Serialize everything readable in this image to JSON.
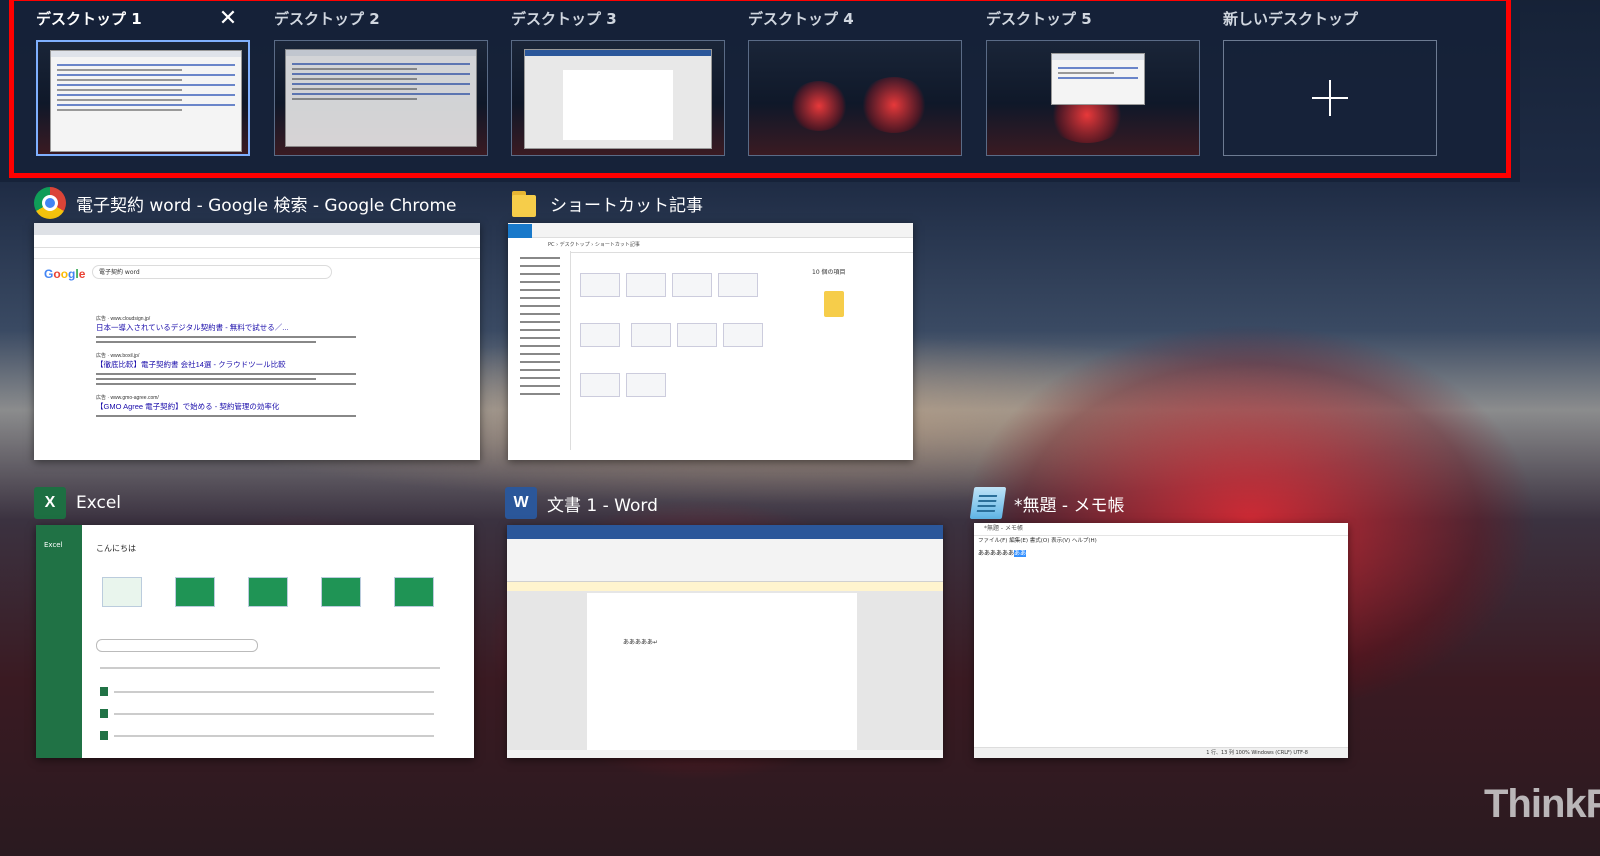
{
  "desktops": [
    {
      "label": "デスクトップ 1",
      "active": true
    },
    {
      "label": "デスクトップ 2",
      "active": false
    },
    {
      "label": "デスクトップ 3",
      "active": false
    },
    {
      "label": "デスクトップ 4",
      "active": false
    },
    {
      "label": "デスクトップ 5",
      "active": false
    }
  ],
  "new_desktop": {
    "label": "新しいデスクトップ"
  },
  "windows": {
    "chrome": {
      "title": "電子契約 word - Google 検索 - Google Chrome",
      "search_query": "電子契約 word",
      "results": [
        {
          "ad": "広告 · www.cloudsign.jp/",
          "link": "日本一導入されているデジタル契約書 - 無料で試せる／..."
        },
        {
          "ad": "広告 · www.boxil.jp/",
          "link": "【徹底比較】電子契約書 会社14選 - クラウドツール比較"
        },
        {
          "ad": "広告 · www.gmo-agree.com/",
          "link": "【GMO Agree 電子契約】で始める - 契約管理の効率化"
        }
      ]
    },
    "explorer": {
      "title": "ショートカット記事",
      "item_count": "10 個の項目",
      "path": "PC › デスクトップ › ショートカット記事"
    },
    "excel": {
      "title": "Excel",
      "app_name": "Excel",
      "greeting": "こんにちは"
    },
    "word": {
      "title": "文書 1 - Word",
      "body_text": "あああああ↵"
    },
    "notepad": {
      "title": "*無題 - メモ帳",
      "window_title": "*無題 - メモ帳",
      "menu": "ファイル(F)  編集(E)  書式(O)  表示(V)  ヘルプ(H)",
      "text": "ああああああ",
      "selected": "ああ",
      "status": "1 行、13 列     100%    Windows (CRLF)     UTF-8"
    }
  },
  "brand": "ThinkP",
  "colors": {
    "highlight": "#ff0000",
    "active_border": "#7fb0ff"
  }
}
